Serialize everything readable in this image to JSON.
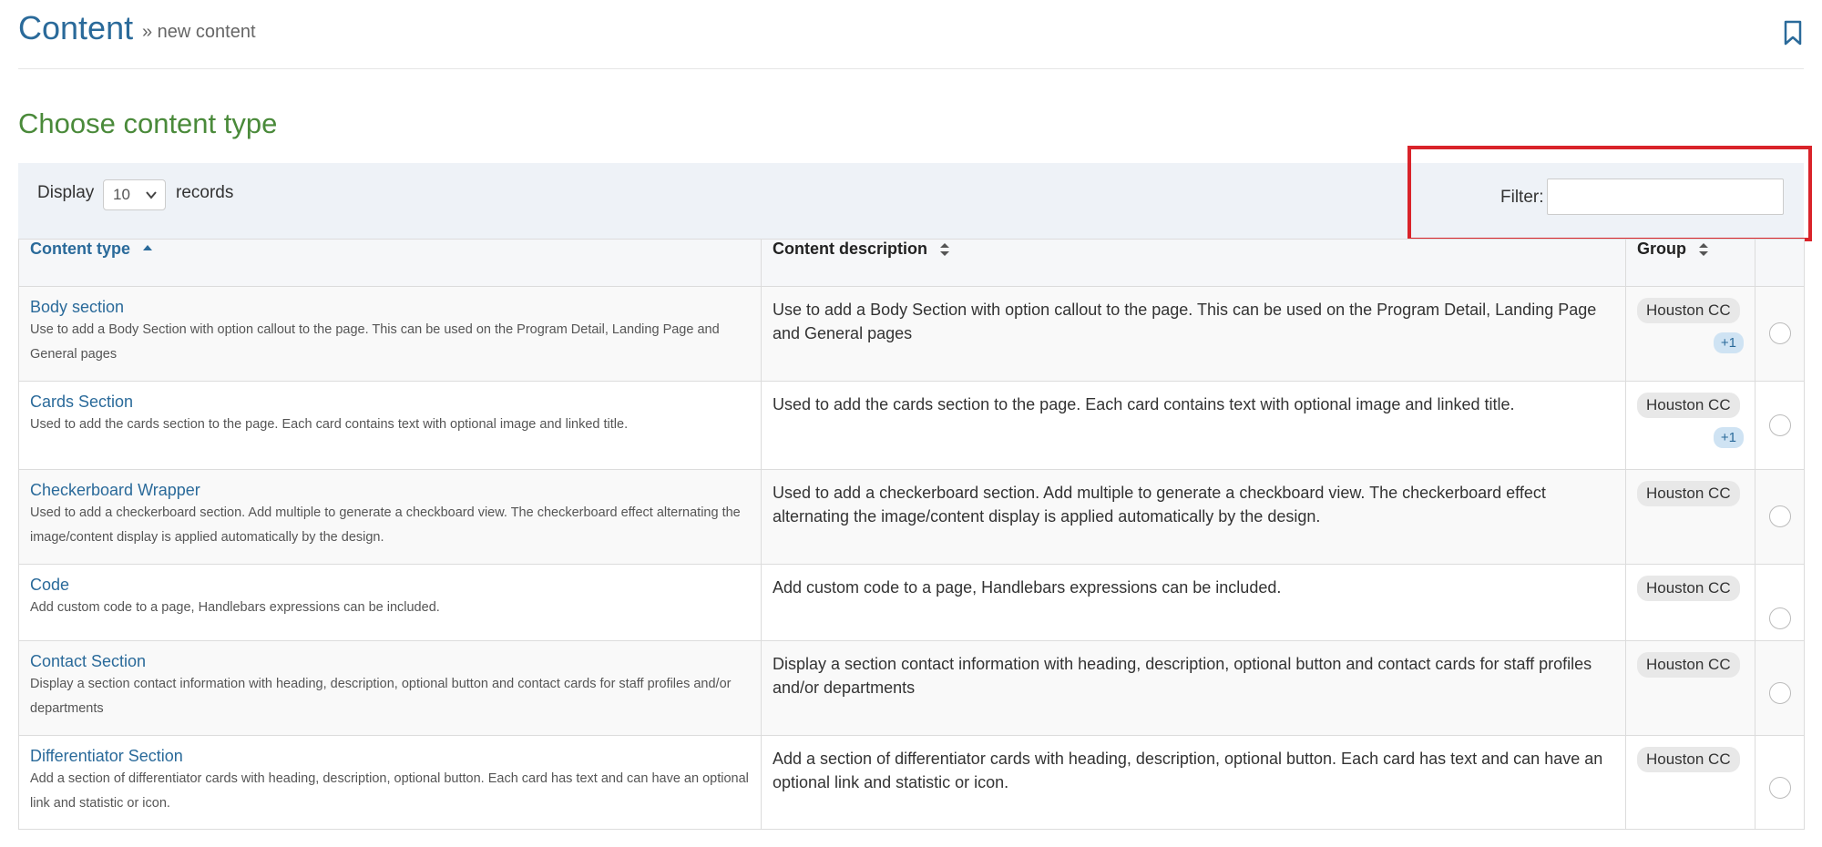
{
  "header": {
    "title": "Content",
    "breadcrumb": "» new content"
  },
  "section_title": "Choose content type",
  "toolbar": {
    "display_label": "Display",
    "page_size": "10",
    "records_label": "records",
    "filter_label": "Filter:",
    "filter_value": ""
  },
  "table": {
    "headers": {
      "type": "Content type",
      "description": "Content description",
      "group": "Group"
    },
    "rows": [
      {
        "name": "Body section",
        "summary": "Use to add a Body Section with option callout to the page. This can be used on the Program Detail, Landing Page and General pages",
        "description": "Use to add a Body Section with option callout to the page. This can be used on the Program Detail, Landing Page and General pages",
        "group": "Houston CC",
        "extra": "+1"
      },
      {
        "name": "Cards Section",
        "summary": "Used to add the cards section to the page. Each card contains text with optional image and linked title.",
        "description": "Used to add the cards section to the page. Each card contains text with optional image and linked title.",
        "group": "Houston CC",
        "extra": "+1"
      },
      {
        "name": "Checkerboard Wrapper",
        "summary": "Used to add a checkerboard section. Add multiple to generate a checkboard view. The checkerboard effect alternating the image/content display is applied automatically by the design.",
        "description": "Used to add a checkerboard section. Add multiple to generate a checkboard view. The checkerboard effect alternating the image/content display is applied automatically by the design.",
        "group": "Houston CC"
      },
      {
        "name": "Code",
        "summary": "Add custom code to a page, Handlebars expressions can be included.",
        "description": "Add custom code to a page, Handlebars expressions can be included.",
        "group": "Houston CC"
      },
      {
        "name": "Contact Section",
        "summary": "Display a section contact information with heading, description, optional button and contact cards for staff profiles and/or departments",
        "description": "Display a section contact information with heading, description, optional button and contact cards for staff profiles and/or departments",
        "group": "Houston CC"
      },
      {
        "name": "Differentiator Section",
        "summary": "Add a section of differentiator cards with heading, description, optional button. Each card has text and can have an optional link and statistic or icon.",
        "description": "Add a section of differentiator cards with heading, description, optional button. Each card has text and can have an optional link and statistic or icon.",
        "group": "Houston CC"
      }
    ]
  }
}
